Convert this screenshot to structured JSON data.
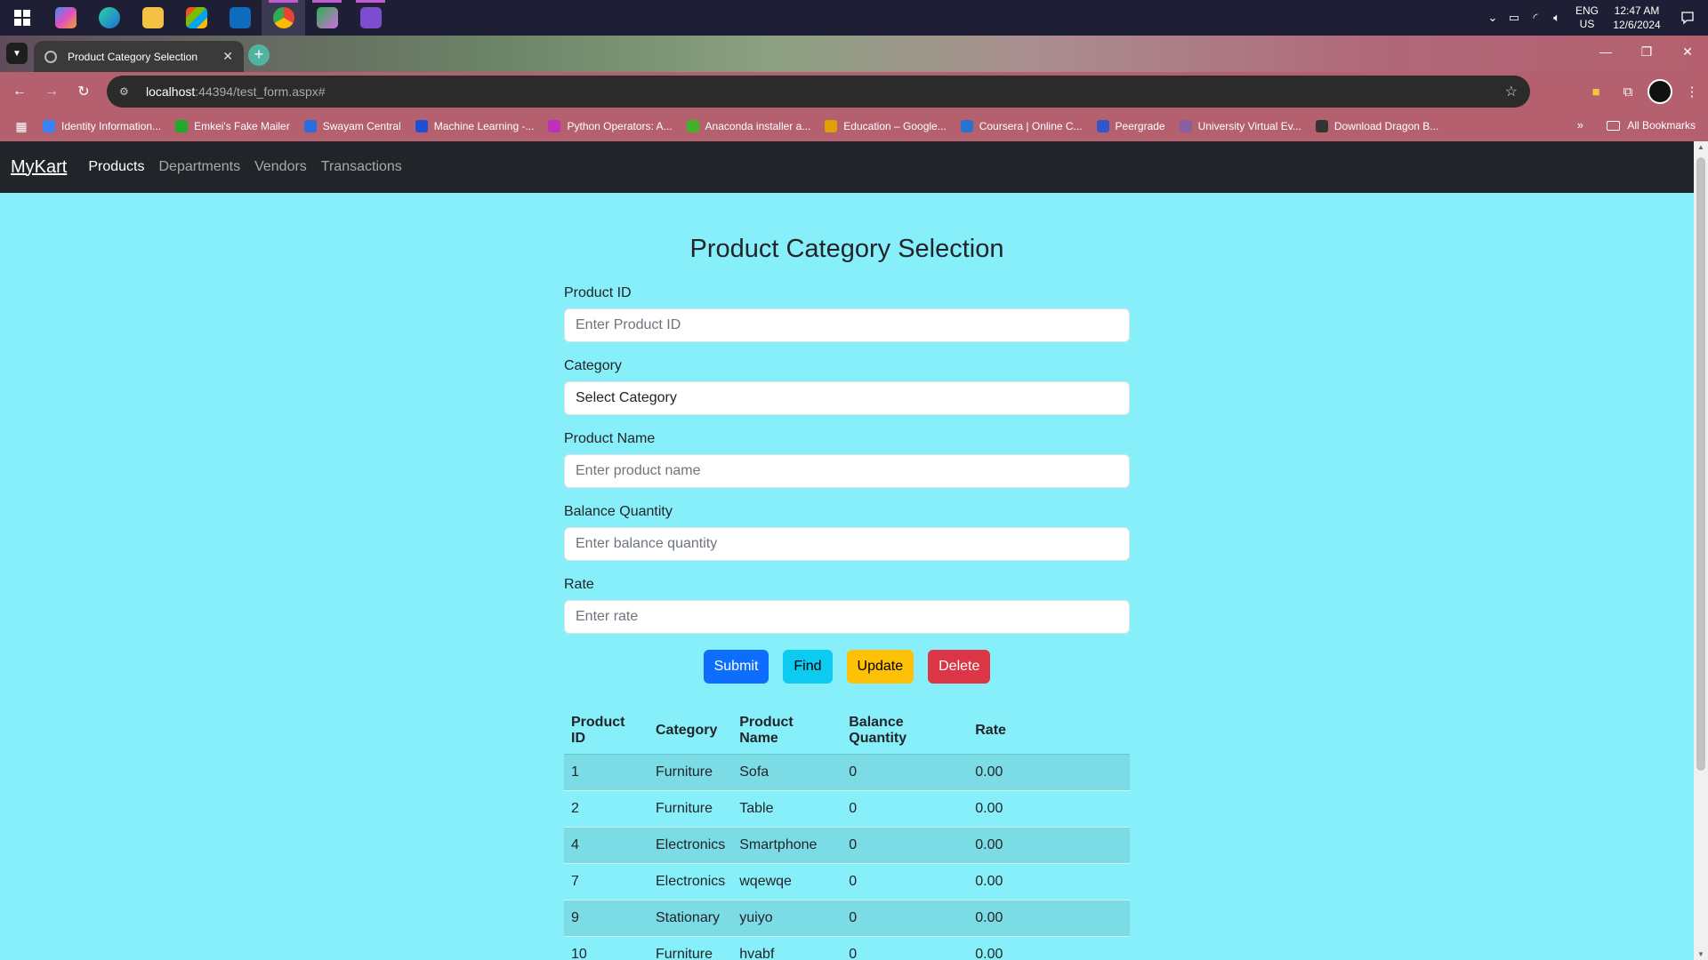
{
  "taskbar": {
    "icons": [
      "windows-start-icon",
      "copilot-icon",
      "edge-icon",
      "file-explorer-icon",
      "microsoft-store-icon",
      "outlook-icon",
      "chrome-icon",
      "snipping-tool-icon",
      "visual-studio-icon"
    ],
    "tray": {
      "lang_top": "ENG",
      "lang_bottom": "US",
      "time": "12:47 AM",
      "date": "12/6/2024"
    }
  },
  "browser": {
    "tab_title": "Product Category Selection",
    "url_host": "localhost",
    "url_path": ":44394/test_form.aspx#",
    "bookmarks": [
      {
        "label": "Identity Information...",
        "color": "#3b82f6"
      },
      {
        "label": "Emkei's Fake Mailer",
        "color": "#22a82a"
      },
      {
        "label": "Swayam Central",
        "color": "#2b6cde"
      },
      {
        "label": "Machine Learning -...",
        "color": "#1c4fd1"
      },
      {
        "label": "Python Operators: A...",
        "color": "#c02fbc"
      },
      {
        "label": "Anaconda installer a...",
        "color": "#43b02a"
      },
      {
        "label": "Education – Google...",
        "color": "#e0a000"
      },
      {
        "label": "Coursera | Online C...",
        "color": "#2a73cc"
      },
      {
        "label": "Peergrade",
        "color": "#3256c8"
      },
      {
        "label": "University Virtual Ev...",
        "color": "#8a5fa0"
      },
      {
        "label": "Download Dragon B...",
        "color": "#333333"
      }
    ],
    "all_bookmarks": "All Bookmarks"
  },
  "navbar": {
    "brand": "MyKart",
    "links": [
      "Products",
      "Departments",
      "Vendors",
      "Transactions"
    ]
  },
  "form": {
    "title": "Product Category Selection",
    "product_id": {
      "label": "Product ID",
      "placeholder": "Enter Product ID"
    },
    "category": {
      "label": "Category",
      "value": "Select Category"
    },
    "product_name": {
      "label": "Product Name",
      "placeholder": "Enter product name"
    },
    "balance_quantity": {
      "label": "Balance Quantity",
      "placeholder": "Enter balance quantity"
    },
    "rate": {
      "label": "Rate",
      "placeholder": "Enter rate"
    },
    "buttons": {
      "submit": "Submit",
      "find": "Find",
      "update": "Update",
      "delete": "Delete"
    }
  },
  "table": {
    "headers": [
      "Product ID",
      "Category",
      "Product Name",
      "Balance Quantity",
      "Rate"
    ],
    "rows": [
      [
        "1",
        "Furniture",
        "Sofa",
        "0",
        "0.00"
      ],
      [
        "2",
        "Furniture",
        "Table",
        "0",
        "0.00"
      ],
      [
        "4",
        "Electronics",
        "Smartphone",
        "0",
        "0.00"
      ],
      [
        "7",
        "Electronics",
        "wqewqe",
        "0",
        "0.00"
      ],
      [
        "9",
        "Stationary",
        "yuiyo",
        "0",
        "0.00"
      ],
      [
        "10",
        "Furniture",
        "hvabf",
        "0",
        "0.00"
      ]
    ]
  },
  "colors": {
    "page_bg": "#87eff9",
    "navbar_bg": "#212529",
    "primary": "#0d6efd",
    "info": "#0dcaf0",
    "warning": "#ffc107",
    "danger": "#dc3545"
  }
}
